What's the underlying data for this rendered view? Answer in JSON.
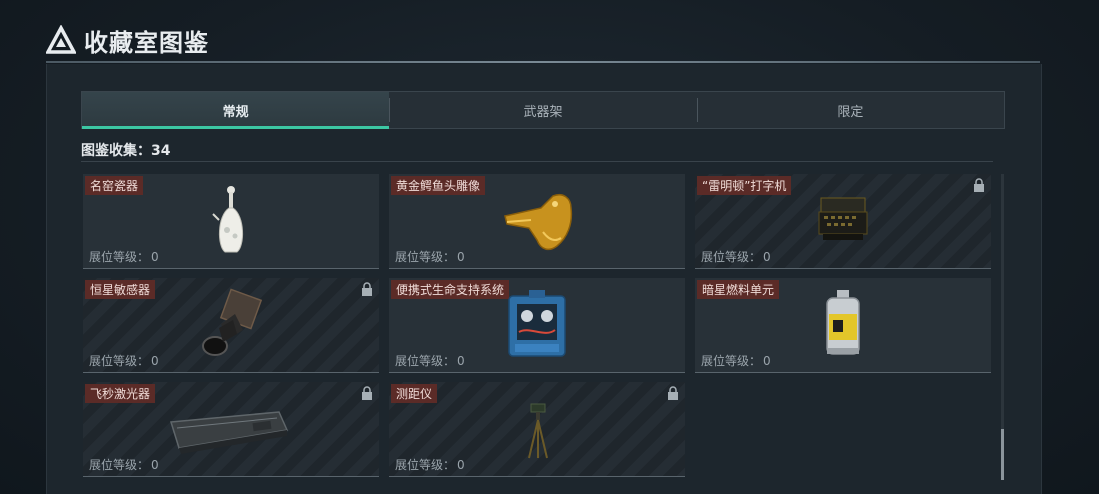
{
  "header": {
    "title": "收藏室图鉴"
  },
  "tabs": [
    {
      "label": "常规",
      "active": true
    },
    {
      "label": "武器架",
      "active": false
    },
    {
      "label": "限定",
      "active": false
    }
  ],
  "collection": {
    "label": "图鉴收集：34"
  },
  "level_label": "展位等级：",
  "items": [
    {
      "name": "名窑瓷器",
      "level": "0",
      "locked": false,
      "icon": "porcelain-vase-icon"
    },
    {
      "name": "黄金鳄鱼头雕像",
      "level": "0",
      "locked": false,
      "icon": "golden-crocodile-head-icon"
    },
    {
      "name": "“雷明顿”打字机",
      "level": "0",
      "locked": true,
      "icon": "typewriter-icon"
    },
    {
      "name": "恒星敏感器",
      "level": "0",
      "locked": true,
      "icon": "star-sensor-icon"
    },
    {
      "name": "便携式生命支持系统",
      "level": "0",
      "locked": false,
      "icon": "life-support-system-icon"
    },
    {
      "name": "暗星燃料单元",
      "level": "0",
      "locked": false,
      "icon": "fuel-cell-icon"
    },
    {
      "name": "飞秒激光器",
      "level": "0",
      "locked": true,
      "icon": "femtosecond-laser-icon"
    },
    {
      "name": "测距仪",
      "level": "0",
      "locked": true,
      "icon": "rangefinder-icon"
    }
  ],
  "colors": {
    "accent": "#3cc7a3",
    "name_tag_bg": "#5b2b27",
    "panel_bg": "#1d262d"
  }
}
